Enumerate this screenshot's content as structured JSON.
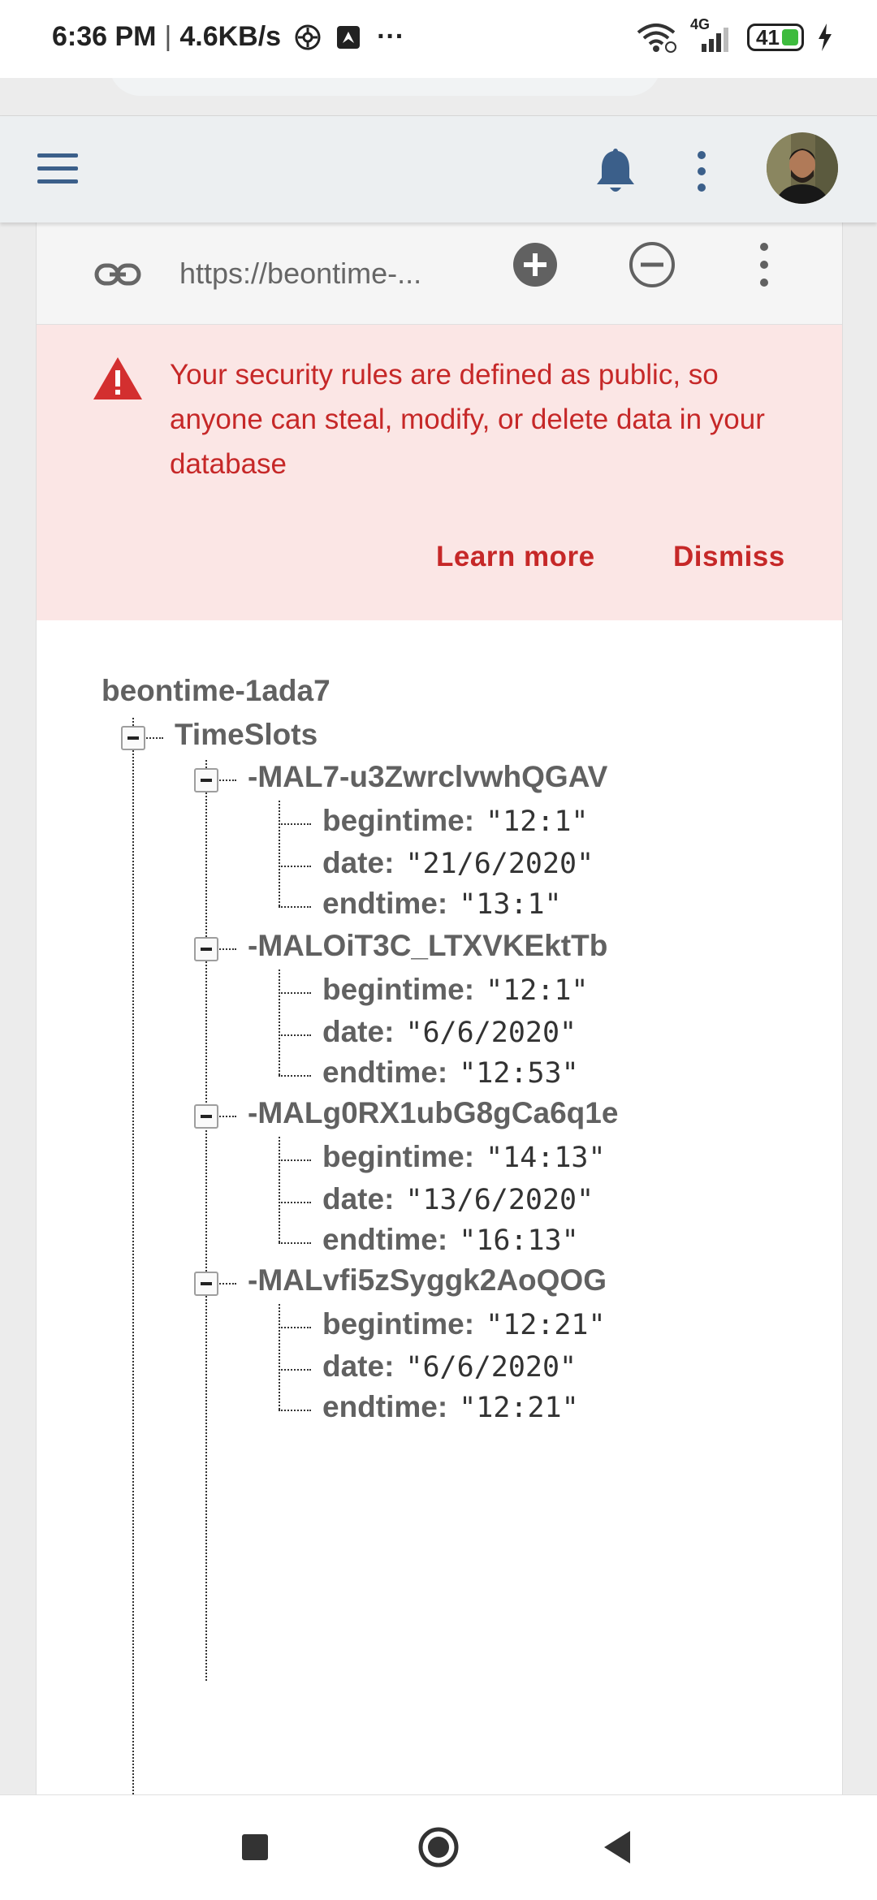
{
  "status_bar": {
    "time": "6:36 PM",
    "separator": "|",
    "speed": "4.6KB/s",
    "more": "···",
    "network": "4G",
    "battery": "41"
  },
  "header": {
    "menu_icon": "hamburger-icon",
    "notifications_icon": "bell-icon",
    "more_icon": "kebab-icon",
    "avatar_icon": "user-avatar"
  },
  "toolbar": {
    "url": "https://beontime-...",
    "link_icon": "link-icon",
    "add_icon": "add-circle-icon",
    "remove_icon": "remove-circle-icon",
    "more_icon": "kebab-icon"
  },
  "alert": {
    "message": "Your security rules are defined as public, so anyone can steal, modify, or delete data in your database",
    "learn_more": "Learn more",
    "dismiss": "Dismiss",
    "color": "#c62828",
    "background": "#fbe6e5"
  },
  "tree": {
    "root": "beontime-1ada7",
    "collection": "TimeSlots",
    "slots": [
      {
        "id": "-MAL7-u3ZwrclvwhQGAV",
        "fields": [
          {
            "key": "begintime:",
            "value": "\"12:1\""
          },
          {
            "key": "date:",
            "value": "\"21/6/2020\""
          },
          {
            "key": "endtime:",
            "value": "\"13:1\""
          }
        ]
      },
      {
        "id": "-MALOiT3C_LTXVKEktTb",
        "fields": [
          {
            "key": "begintime:",
            "value": "\"12:1\""
          },
          {
            "key": "date:",
            "value": "\"6/6/2020\""
          },
          {
            "key": "endtime:",
            "value": "\"12:53\""
          }
        ]
      },
      {
        "id": "-MALg0RX1ubG8gCa6q1e",
        "fields": [
          {
            "key": "begintime:",
            "value": "\"14:13\""
          },
          {
            "key": "date:",
            "value": "\"13/6/2020\""
          },
          {
            "key": "endtime:",
            "value": "\"16:13\""
          }
        ]
      },
      {
        "id": "-MALvfi5zSyggk2AoQOG",
        "fields": [
          {
            "key": "begintime:",
            "value": "\"12:21\""
          },
          {
            "key": "date:",
            "value": "\"6/6/2020\""
          },
          {
            "key": "endtime:",
            "value": "\"12:21\""
          }
        ]
      }
    ]
  },
  "nav": {
    "recents_icon": "square-icon",
    "home_icon": "home-circle-icon",
    "back_icon": "back-triangle-icon"
  }
}
